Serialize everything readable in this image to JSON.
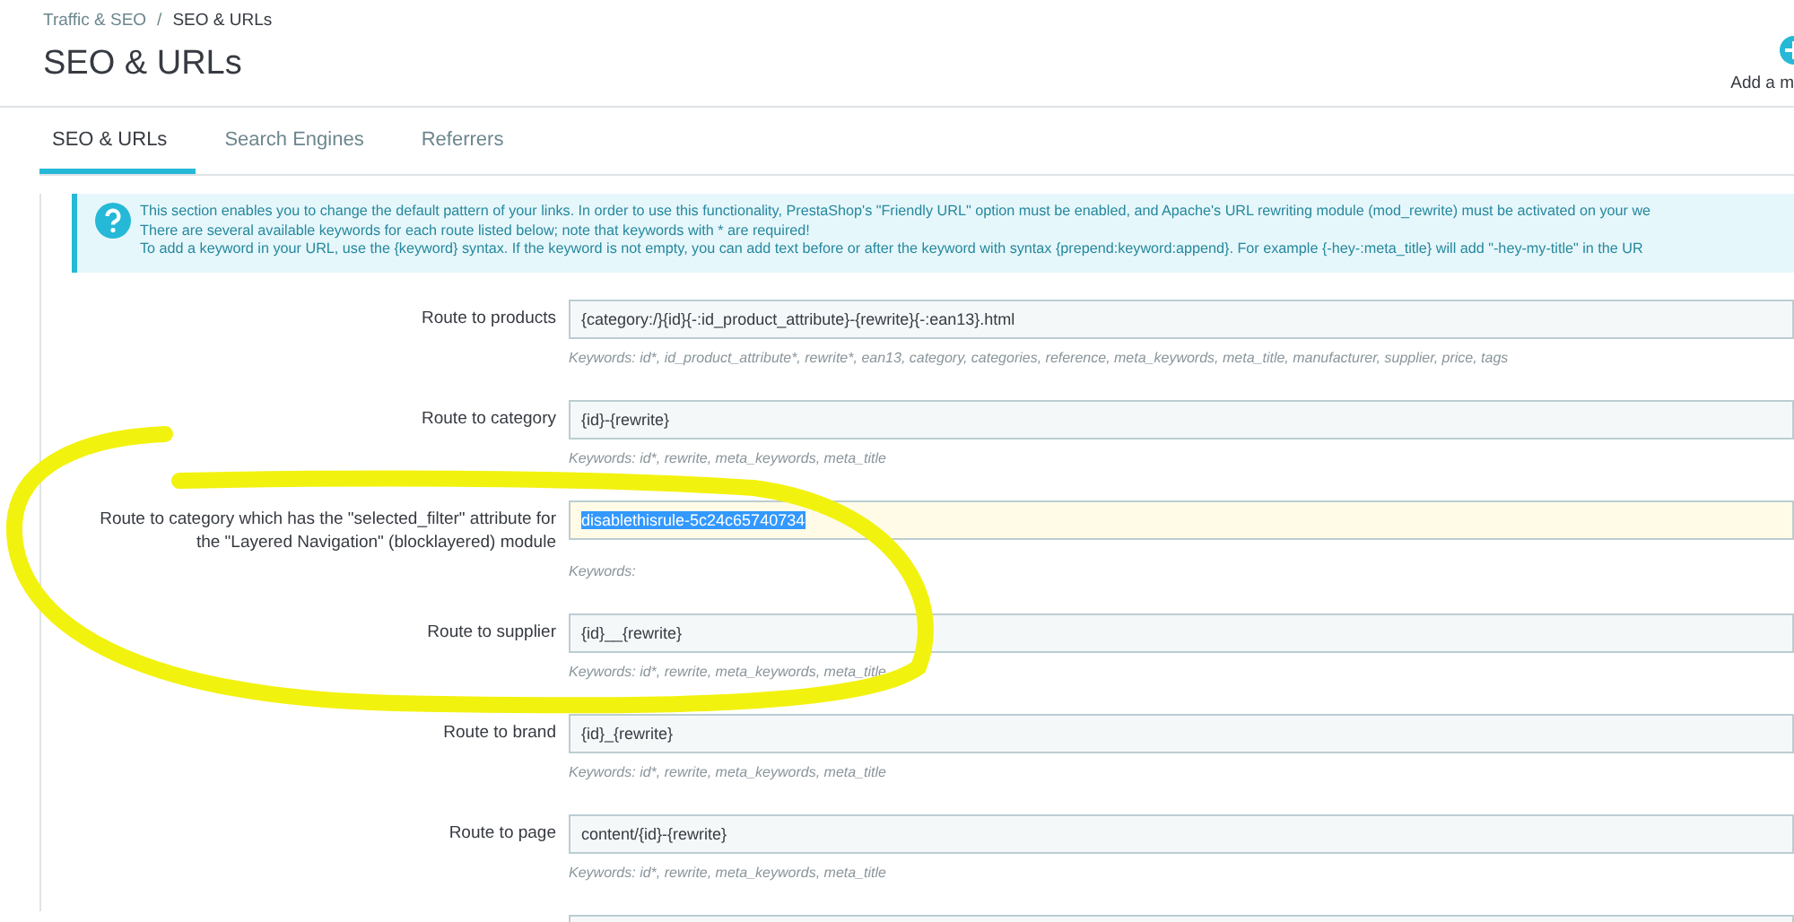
{
  "breadcrumb": [
    "Traffic & SEO",
    "SEO & URLs"
  ],
  "breadcrumb_separator": "/",
  "page_title": "SEO & URLs",
  "toolbar": {
    "add_label": "Add a m"
  },
  "tabs": [
    {
      "label": "SEO & URLs",
      "selected": true
    },
    {
      "label": "Search Engines",
      "selected": false
    },
    {
      "label": "Referrers",
      "selected": false
    }
  ],
  "info_alert": [
    "This section enables you to change the default pattern of your links. In order to use this functionality, PrestaShop's \"Friendly URL\" option must be enabled, and Apache's URL rewriting module (mod_rewrite) must be activated on your we",
    "There are several available keywords for each route listed below; note that keywords with * are required!",
    "To add a keyword in your URL, use the {keyword} syntax. If the keyword is not empty, you can add text before or after the keyword with syntax {prepend:keyword:append}. For example {-hey-:meta_title} will add \"-hey-my-title\" in the UR"
  ],
  "routes": [
    {
      "label": "Route to products",
      "value": "{category:/}{id}{-:id_product_attribute}-{rewrite}{-:ean13}.html",
      "help": "Keywords: id*, id_product_attribute*, rewrite*, ean13, category, categories, reference, meta_keywords, meta_title, manufacturer, supplier, price, tags",
      "focused": false
    },
    {
      "label": "Route to category",
      "value": "{id}-{rewrite}",
      "help": "Keywords: id*, rewrite, meta_keywords, meta_title",
      "focused": false
    },
    {
      "label": "Route to category which has the \"selected_filter\" attribute for the \"Layered Navigation\" (blocklayered) module",
      "value": "disablethisrule-5c24c65740734",
      "help": "Keywords:",
      "focused": true
    },
    {
      "label": "Route to supplier",
      "value": "{id}__{rewrite}",
      "help": "Keywords: id*, rewrite, meta_keywords, meta_title",
      "focused": false
    },
    {
      "label": "Route to brand",
      "value": "{id}_{rewrite}",
      "help": "Keywords: id*, rewrite, meta_keywords, meta_title",
      "focused": false
    },
    {
      "label": "Route to page",
      "value": "content/{id}-{rewrite}",
      "help": "Keywords: id*, rewrite, meta_keywords, meta_title",
      "focused": false
    },
    {
      "focused": false
    }
  ]
}
